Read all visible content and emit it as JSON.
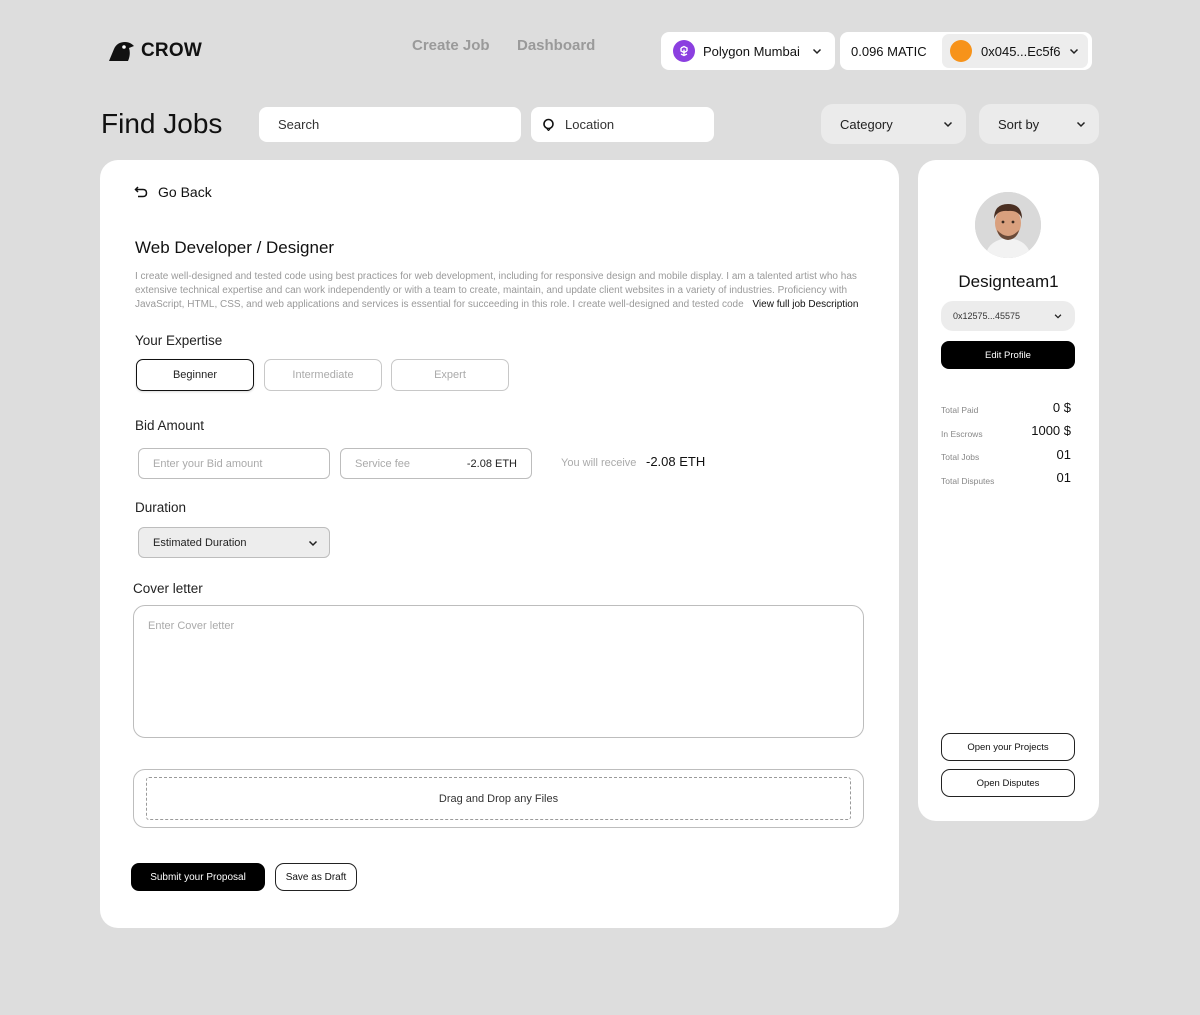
{
  "header": {
    "brand": "CROW",
    "nav": [
      "Create Job",
      "Dashboard"
    ],
    "network": "Polygon Mumbai",
    "balance": "0.096 MATIC",
    "wallet_address": "0x045...Ec5f6"
  },
  "title_row": {
    "title": "Find Jobs",
    "search_placeholder": "Search",
    "location_placeholder": "Location",
    "category_label": "Category",
    "sort_label": "Sort by"
  },
  "job": {
    "back_label": "Go Back",
    "title": "Web Developer / Designer",
    "description": "I create well-designed and tested code using best practices for web development, including for responsive design and mobile display. I am a talented artist who has extensive technical expertise and can work independently or with a team to create, maintain, and update client websites in a variety of industries. Proficiency with JavaScript, HTML, CSS, and web applications and services is essential for succeeding in this role. I create well-designed and tested code",
    "view_full_label": "View full job Description",
    "expertise_label": "Your Expertise",
    "levels": [
      "Beginner",
      "Intermediate",
      "Expert"
    ],
    "selected_level": "Beginner",
    "bid_label": "Bid Amount",
    "bid_placeholder": "Enter your Bid amount",
    "service_fee_label": "Service fee",
    "service_fee_value": "-2.08 ETH",
    "receive_label": "You will receive",
    "receive_value": "-2.08 ETH",
    "duration_label": "Duration",
    "duration_value": "Estimated Duration",
    "cover_label": "Cover letter",
    "cover_placeholder": "Enter Cover letter",
    "dropzone_label": "Drag and Drop any Files",
    "submit_label": "Submit your Proposal",
    "draft_label": "Save as Draft"
  },
  "profile": {
    "name": "Designteam1",
    "address": "0x12575...45575",
    "edit_label": "Edit Profile",
    "stats": [
      {
        "label": "Total Paid",
        "value": "0 $"
      },
      {
        "label": "In Escrows",
        "value": "1000 $"
      },
      {
        "label": "Total Jobs",
        "value": "01"
      },
      {
        "label": "Total Disputes",
        "value": "01"
      }
    ],
    "open_projects_label": "Open your Projects",
    "open_disputes_label": "Open Disputes"
  },
  "colors": {
    "background": "#dddddd",
    "network_icon": "#8b3fe0",
    "wallet_dot": "#f7931a",
    "primary_button": "#000000"
  },
  "icons": [
    "crow-logo-icon",
    "polygon-icon",
    "chevron-down-icon",
    "location-icon",
    "back-arrow-icon",
    "user-avatar"
  ]
}
